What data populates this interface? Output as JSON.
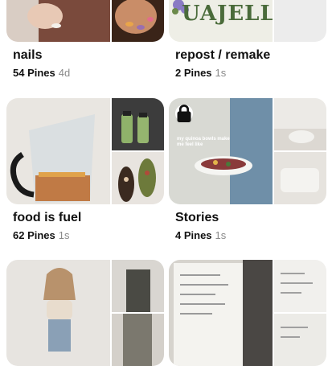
{
  "boards": [
    {
      "title": "nails",
      "pins": "54 Pines",
      "age": "4d"
    },
    {
      "title": "repost / remake",
      "pins": "2 Pines",
      "age": "1s",
      "wordmark": "UAJELL"
    },
    {
      "title": "food is fuel",
      "pins": "62 Pines",
      "age": "1s"
    },
    {
      "title": "Stories",
      "pins": "4 Pines",
      "age": "1s",
      "overlay": "my quinoa bowls make me feel like",
      "locked": true
    },
    {
      "title": "",
      "pins": "",
      "age": ""
    },
    {
      "title": "",
      "pins": "",
      "age": ""
    }
  ],
  "colors": {
    "accent": "#4a6b3a",
    "meta_gray": "#8a8a8a"
  },
  "icons": {
    "lock": "lock-icon"
  }
}
